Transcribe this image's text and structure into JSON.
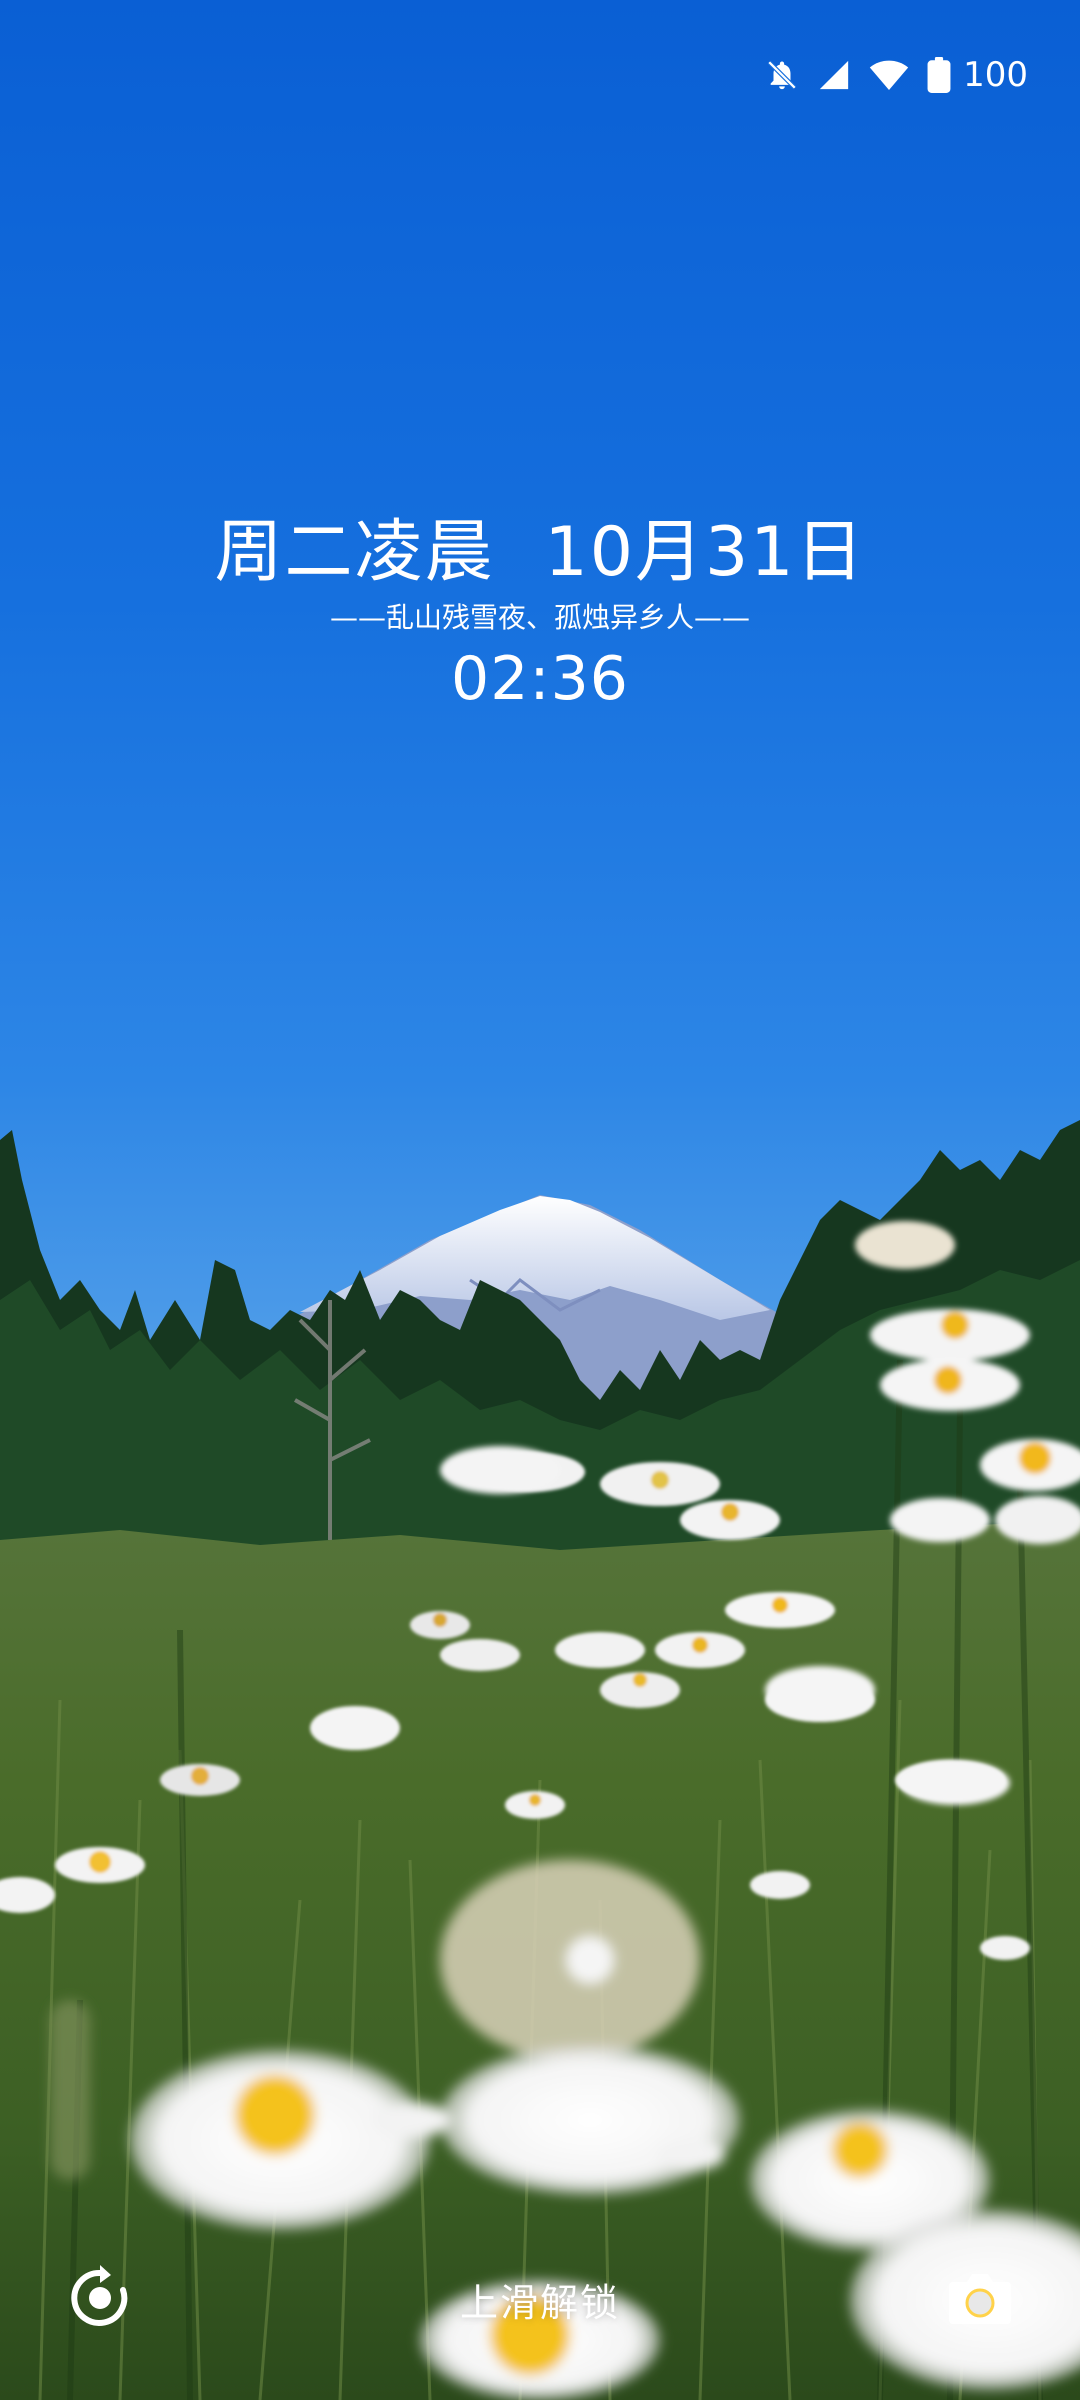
{
  "status_bar": {
    "icons": [
      "bell-muted-icon",
      "cellular-signal-icon",
      "wifi-icon",
      "battery-icon"
    ],
    "battery_level": "100"
  },
  "lockscreen": {
    "weekday_period": "周二凌晨",
    "date": "10月31日",
    "poem": "——乱山残雪夜、孤烛异乡人——",
    "time": "02:36",
    "unlock_hint": "上滑解锁"
  },
  "shortcuts": {
    "left_icon": "refresh-wallpaper-icon",
    "right_icon": "camera-icon"
  },
  "wallpaper": {
    "description_colors": {
      "sky_top": "#0a5fd4",
      "sky_bottom": "#6faee8",
      "forest": "#123a20",
      "meadow": "#3f6a26"
    }
  }
}
